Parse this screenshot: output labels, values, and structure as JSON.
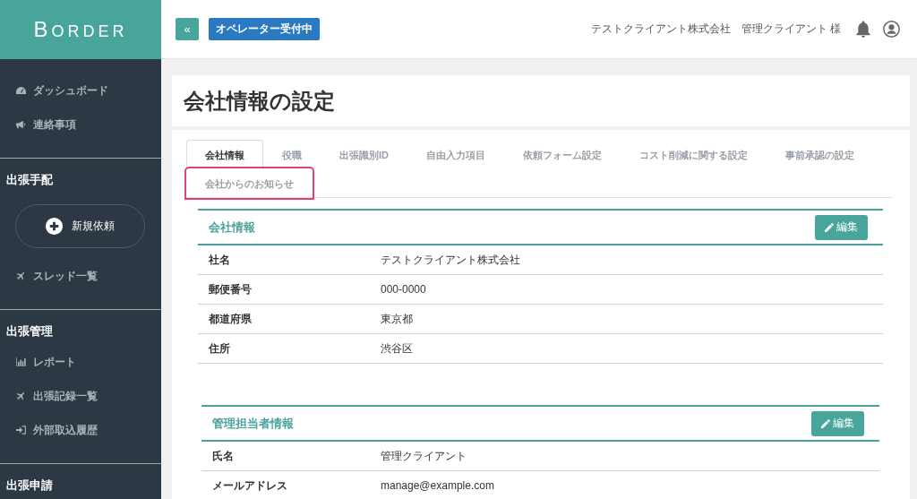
{
  "sidebar": {
    "logo": "BORDER",
    "sections": [
      {
        "items": [
          {
            "label": "ダッシュボード"
          },
          {
            "label": "連絡事項"
          }
        ]
      },
      {
        "heading": "出張手配",
        "action": "新規依頼",
        "items": [
          {
            "label": "スレッド一覧"
          }
        ]
      },
      {
        "heading": "出張管理",
        "items": [
          {
            "label": "レポート"
          },
          {
            "label": "出張記録一覧"
          },
          {
            "label": "外部取込履歴"
          }
        ]
      },
      {
        "heading": "出張申請"
      }
    ]
  },
  "topbar": {
    "collapse_button": "«",
    "status_button": "オペレーター受付中",
    "company": "テストクライアント株式会社",
    "user": "管理クライアント 様"
  },
  "page": {
    "title": "会社情報の設定",
    "tabs": [
      {
        "label": "会社情報",
        "selected": true,
        "highlighted": false
      },
      {
        "label": "役職",
        "selected": false,
        "highlighted": false
      },
      {
        "label": "出張識別ID",
        "selected": false,
        "highlighted": false
      },
      {
        "label": "自由入力項目",
        "selected": false,
        "highlighted": false
      },
      {
        "label": "依頼フォーム設定",
        "selected": false,
        "highlighted": false
      },
      {
        "label": "コスト削減に関する設定",
        "selected": false,
        "highlighted": false
      },
      {
        "label": "事前承認の設定",
        "selected": false,
        "highlighted": false
      },
      {
        "label": "会社からのお知らせ",
        "selected": false,
        "highlighted": true
      }
    ],
    "panels": [
      {
        "title": "会社情報",
        "edit_button": "編集",
        "rows": [
          {
            "label": "社名",
            "value": "テストクライアント株式会社"
          },
          {
            "label": "郵便番号",
            "value": "000-0000"
          },
          {
            "label": "都道府県",
            "value": "東京都"
          },
          {
            "label": "住所",
            "value": "渋谷区"
          }
        ]
      },
      {
        "title": "管理担当者情報",
        "edit_button": "編集",
        "rows": [
          {
            "label": "氏名",
            "value": "管理クライアント"
          },
          {
            "label": "メールアドレス",
            "value": "manage@example.com"
          }
        ]
      }
    ]
  }
}
